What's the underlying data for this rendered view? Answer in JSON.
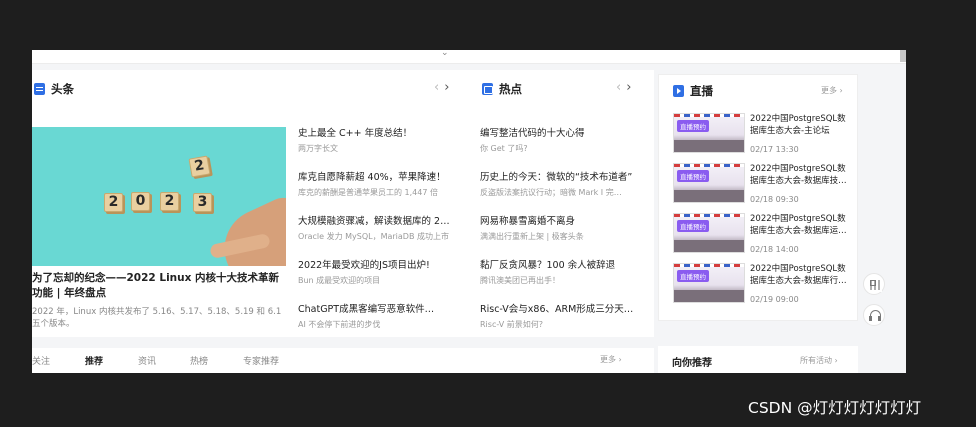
{
  "headline": {
    "title": "头条",
    "hero": {
      "dice": [
        "2",
        "0",
        "2",
        "3",
        "2"
      ],
      "title": "为了忘却的纪念——2022 Linux 内核十大技术革新功能 | 年终盘点",
      "desc": "2022 年，Linux 内核共发布了 5.16、5.17、5.18、5.19 和 6.1 五个版本。"
    },
    "items": [
      {
        "title": "史上最全 C++ 年度总结！",
        "sub": "两万字长文"
      },
      {
        "title": "库克自愿降薪超 40%，苹果降速！",
        "sub": "库克的薪酬是普通苹果员工的 1,447 倍"
      },
      {
        "title": "大规模融资骤减，解读数据库的 2…",
        "sub": "Oracle 发力 MySQL，MariaDB 成功上市"
      },
      {
        "title": "2022年最受欢迎的JS项目出炉!",
        "sub": "Bun 成最受欢迎的项目"
      },
      {
        "title": "ChatGPT成黑客编写恶意软件…",
        "sub": "AI 不会停下前进的步伐"
      }
    ]
  },
  "hot": {
    "title": "热点",
    "items": [
      {
        "title": "编写整洁代码的十大心得",
        "sub": "你 Get 了吗?"
      },
      {
        "title": "历史上的今天：微软的“技术布道者”",
        "sub": "反盗版法案抗议行动；暗微 Mark I 完…"
      },
      {
        "title": "网易称暴雪离婚不离身",
        "sub": "满满出行重新上架 | 极客头条"
      },
      {
        "title": "黏厂反贪风暴？100 余人被辞退",
        "sub": "腾讯澳美团已再出手！"
      },
      {
        "title": "Risc-V会与x86、ARM形成三分天…",
        "sub": "Risc-V 前景如何?"
      }
    ]
  },
  "live": {
    "title": "直播",
    "more": "更多",
    "tag": "直播预约",
    "items": [
      {
        "title": "2022中国PostgreSQL数据库生态大会-主论坛",
        "date": "02/17 13:30"
      },
      {
        "title": "2022中国PostgreSQL数据库生态大会-数据库技…",
        "date": "02/18 09:30"
      },
      {
        "title": "2022中国PostgreSQL数据库生态大会-数据库运…",
        "date": "02/18 14:00"
      },
      {
        "title": "2022中国PostgreSQL数据库生态大会-数据库行…",
        "date": "02/19 09:00"
      }
    ]
  },
  "tabs": [
    "关注",
    "推荐",
    "资讯",
    "热榜",
    "专家推荐"
  ],
  "tabs_more": "更多",
  "recommend": {
    "title": "向你推荐",
    "more": "所有活动"
  },
  "nav": {
    "prev": "‹",
    "next": "›"
  },
  "watermark": "CSDN @灯灯灯灯灯灯灯"
}
